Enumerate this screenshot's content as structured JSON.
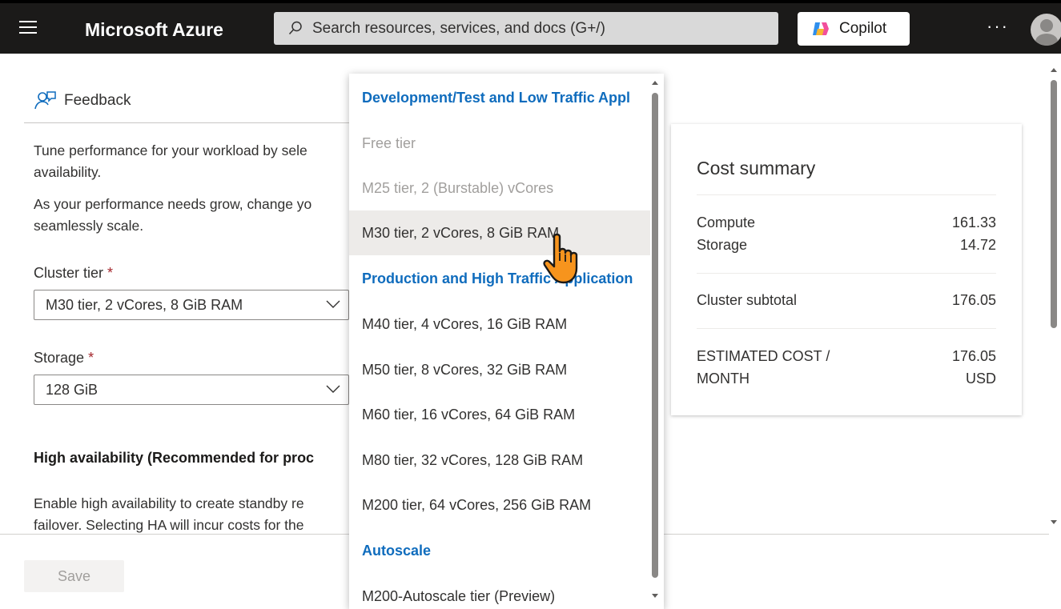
{
  "topbar": {
    "title": "Microsoft Azure",
    "search_placeholder": "Search resources, services, and docs (G+/)",
    "copilot_label": "Copilot",
    "more_label": "···"
  },
  "feedback": {
    "label": "Feedback"
  },
  "intro": {
    "line1": "Tune performance for your workload by sele",
    "line2": "availability.",
    "line3": "As your performance needs grow, change yo",
    "line4": "seamlessly scale."
  },
  "cluster_tier": {
    "label": "Cluster tier",
    "required_mark": "*",
    "value": "M30 tier, 2 vCores, 8 GiB RAM"
  },
  "storage": {
    "label": "Storage",
    "required_mark": "*",
    "value": "128 GiB"
  },
  "high_availability": {
    "heading": "High availability (Recommended for proc",
    "line1": "Enable high availability to create standby re",
    "line2": "failover. Selecting HA will incur costs for the"
  },
  "footer": {
    "save_label": "Save"
  },
  "cost_summary": {
    "title": "Cost summary",
    "compute_label": "Compute",
    "compute_value": "161.33",
    "storage_label": "Storage",
    "storage_value": "14.72",
    "subtotal_label": "Cluster subtotal",
    "subtotal_value": "176.05",
    "estimated_label_1": "ESTIMATED COST /",
    "estimated_label_2": "MONTH",
    "estimated_value": "176.05",
    "estimated_currency": "USD"
  },
  "dropdown": {
    "items": [
      {
        "label": "Development/Test and Low Traffic Appl",
        "kind": "header"
      },
      {
        "label": "Free tier",
        "kind": "disabled"
      },
      {
        "label": "M25 tier, 2 (Burstable) vCores",
        "kind": "disabled"
      },
      {
        "label": "M30 tier, 2 vCores, 8 GiB RAM",
        "kind": "hover"
      },
      {
        "label": "Production and High Traffic Application",
        "kind": "header"
      },
      {
        "label": "M40 tier, 4 vCores, 16 GiB RAM",
        "kind": "normal"
      },
      {
        "label": "M50 tier, 8 vCores, 32 GiB RAM",
        "kind": "normal"
      },
      {
        "label": "M60 tier, 16 vCores, 64 GiB RAM",
        "kind": "normal"
      },
      {
        "label": "M80 tier, 32 vCores, 128 GiB RAM",
        "kind": "normal"
      },
      {
        "label": "M200 tier, 64 vCores, 256 GiB RAM",
        "kind": "normal"
      },
      {
        "label": "Autoscale",
        "kind": "header"
      },
      {
        "label": "M200-Autoscale tier (Preview)",
        "kind": "normal"
      }
    ]
  },
  "colors": {
    "topbar_bg": "#1b1a19",
    "link_blue": "#0f6cbd",
    "required_red": "#a4262c"
  }
}
